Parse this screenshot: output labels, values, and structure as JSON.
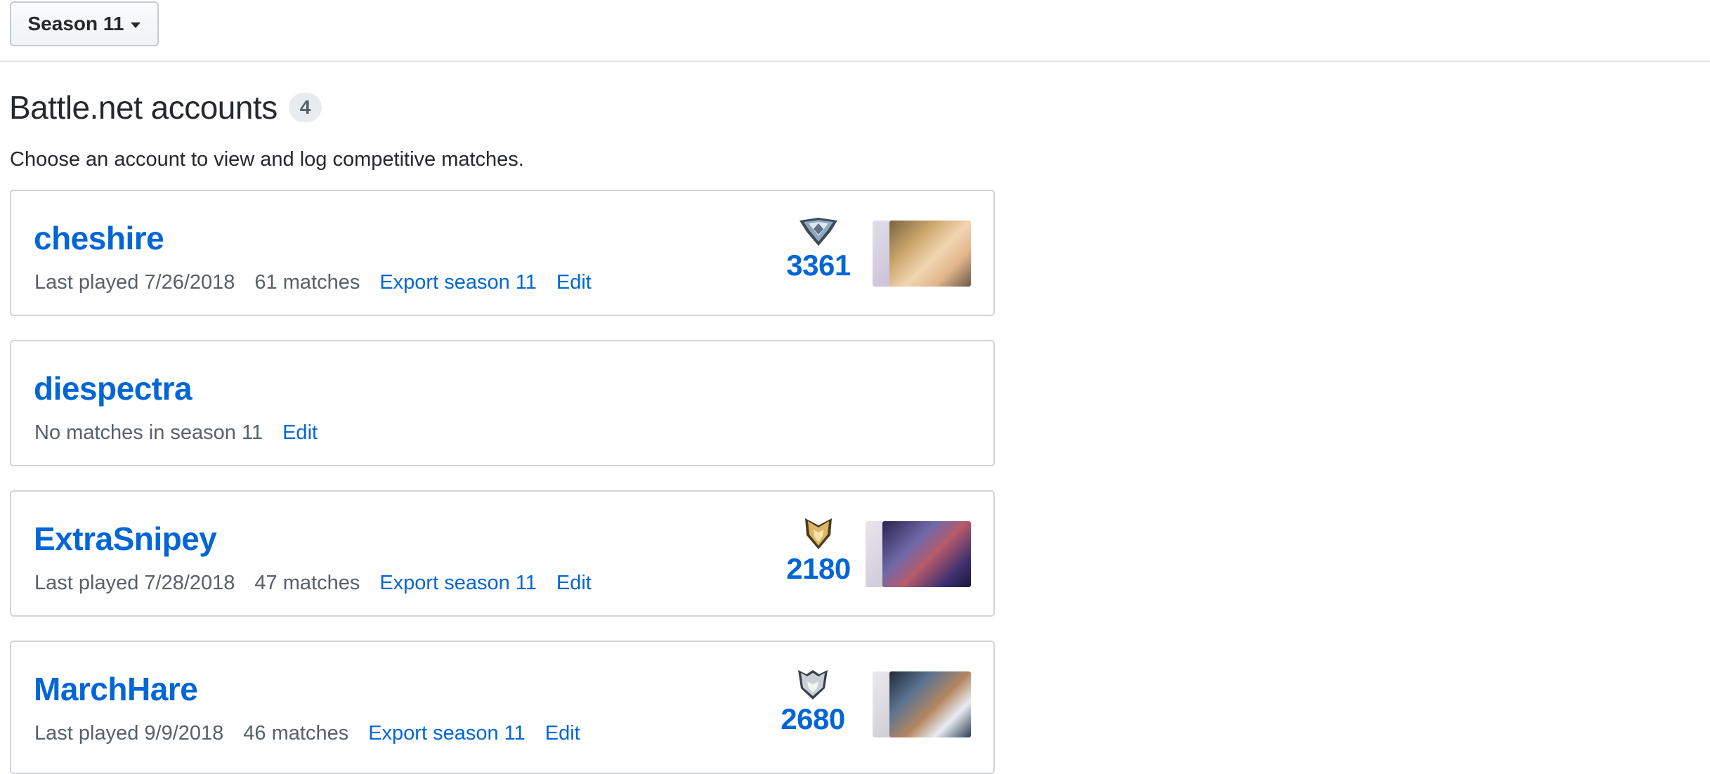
{
  "season_selector": {
    "label": "Season 11"
  },
  "header": {
    "title": "Battle.net accounts",
    "count": "4"
  },
  "subtitle": "Choose an account to view and log competitive matches.",
  "accounts": [
    {
      "name": "cheshire",
      "last_played": "Last played 7/26/2018",
      "matches": "61 matches",
      "export_label": "Export season 11",
      "edit_label": "Edit",
      "sr": "3361",
      "rank_icon": "master-rank-icon",
      "heroes": [
        "mercy"
      ]
    },
    {
      "name": "diespectra",
      "status": "No matches in season 11",
      "edit_label": "Edit"
    },
    {
      "name": "ExtraSnipey",
      "last_played": "Last played 7/28/2018",
      "matches": "47 matches",
      "export_label": "Export season 11",
      "edit_label": "Edit",
      "sr": "2180",
      "rank_icon": "gold-rank-icon",
      "heroes": [
        "widowmaker"
      ]
    },
    {
      "name": "MarchHare",
      "last_played": "Last played 9/9/2018",
      "matches": "46 matches",
      "export_label": "Export season 11",
      "edit_label": "Edit",
      "sr": "2680",
      "rank_icon": "platinum-rank-icon",
      "heroes": [
        "symmetra"
      ]
    }
  ],
  "colors": {
    "link": "#0366d6",
    "text": "#24292e",
    "muted": "#586069",
    "border": "#d1d5da"
  }
}
